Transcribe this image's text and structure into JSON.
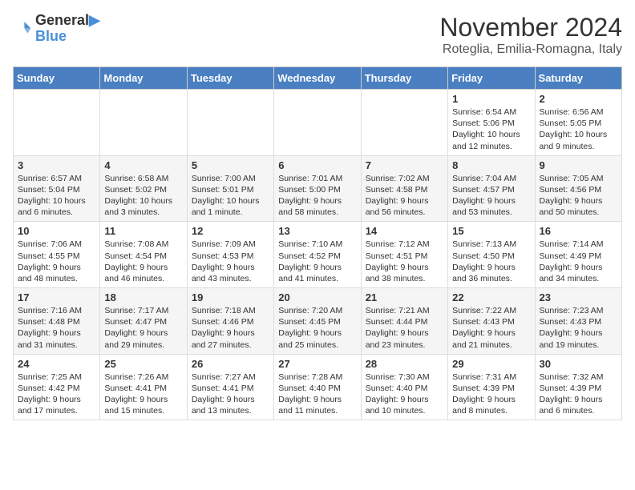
{
  "header": {
    "logo_line1": "General",
    "logo_line2": "Blue",
    "month": "November 2024",
    "location": "Roteglia, Emilia-Romagna, Italy"
  },
  "days_of_week": [
    "Sunday",
    "Monday",
    "Tuesday",
    "Wednesday",
    "Thursday",
    "Friday",
    "Saturday"
  ],
  "weeks": [
    [
      {
        "day": "",
        "info": ""
      },
      {
        "day": "",
        "info": ""
      },
      {
        "day": "",
        "info": ""
      },
      {
        "day": "",
        "info": ""
      },
      {
        "day": "",
        "info": ""
      },
      {
        "day": "1",
        "info": "Sunrise: 6:54 AM\nSunset: 5:06 PM\nDaylight: 10 hours and 12 minutes."
      },
      {
        "day": "2",
        "info": "Sunrise: 6:56 AM\nSunset: 5:05 PM\nDaylight: 10 hours and 9 minutes."
      }
    ],
    [
      {
        "day": "3",
        "info": "Sunrise: 6:57 AM\nSunset: 5:04 PM\nDaylight: 10 hours and 6 minutes."
      },
      {
        "day": "4",
        "info": "Sunrise: 6:58 AM\nSunset: 5:02 PM\nDaylight: 10 hours and 3 minutes."
      },
      {
        "day": "5",
        "info": "Sunrise: 7:00 AM\nSunset: 5:01 PM\nDaylight: 10 hours and 1 minute."
      },
      {
        "day": "6",
        "info": "Sunrise: 7:01 AM\nSunset: 5:00 PM\nDaylight: 9 hours and 58 minutes."
      },
      {
        "day": "7",
        "info": "Sunrise: 7:02 AM\nSunset: 4:58 PM\nDaylight: 9 hours and 56 minutes."
      },
      {
        "day": "8",
        "info": "Sunrise: 7:04 AM\nSunset: 4:57 PM\nDaylight: 9 hours and 53 minutes."
      },
      {
        "day": "9",
        "info": "Sunrise: 7:05 AM\nSunset: 4:56 PM\nDaylight: 9 hours and 50 minutes."
      }
    ],
    [
      {
        "day": "10",
        "info": "Sunrise: 7:06 AM\nSunset: 4:55 PM\nDaylight: 9 hours and 48 minutes."
      },
      {
        "day": "11",
        "info": "Sunrise: 7:08 AM\nSunset: 4:54 PM\nDaylight: 9 hours and 46 minutes."
      },
      {
        "day": "12",
        "info": "Sunrise: 7:09 AM\nSunset: 4:53 PM\nDaylight: 9 hours and 43 minutes."
      },
      {
        "day": "13",
        "info": "Sunrise: 7:10 AM\nSunset: 4:52 PM\nDaylight: 9 hours and 41 minutes."
      },
      {
        "day": "14",
        "info": "Sunrise: 7:12 AM\nSunset: 4:51 PM\nDaylight: 9 hours and 38 minutes."
      },
      {
        "day": "15",
        "info": "Sunrise: 7:13 AM\nSunset: 4:50 PM\nDaylight: 9 hours and 36 minutes."
      },
      {
        "day": "16",
        "info": "Sunrise: 7:14 AM\nSunset: 4:49 PM\nDaylight: 9 hours and 34 minutes."
      }
    ],
    [
      {
        "day": "17",
        "info": "Sunrise: 7:16 AM\nSunset: 4:48 PM\nDaylight: 9 hours and 31 minutes."
      },
      {
        "day": "18",
        "info": "Sunrise: 7:17 AM\nSunset: 4:47 PM\nDaylight: 9 hours and 29 minutes."
      },
      {
        "day": "19",
        "info": "Sunrise: 7:18 AM\nSunset: 4:46 PM\nDaylight: 9 hours and 27 minutes."
      },
      {
        "day": "20",
        "info": "Sunrise: 7:20 AM\nSunset: 4:45 PM\nDaylight: 9 hours and 25 minutes."
      },
      {
        "day": "21",
        "info": "Sunrise: 7:21 AM\nSunset: 4:44 PM\nDaylight: 9 hours and 23 minutes."
      },
      {
        "day": "22",
        "info": "Sunrise: 7:22 AM\nSunset: 4:43 PM\nDaylight: 9 hours and 21 minutes."
      },
      {
        "day": "23",
        "info": "Sunrise: 7:23 AM\nSunset: 4:43 PM\nDaylight: 9 hours and 19 minutes."
      }
    ],
    [
      {
        "day": "24",
        "info": "Sunrise: 7:25 AM\nSunset: 4:42 PM\nDaylight: 9 hours and 17 minutes."
      },
      {
        "day": "25",
        "info": "Sunrise: 7:26 AM\nSunset: 4:41 PM\nDaylight: 9 hours and 15 minutes."
      },
      {
        "day": "26",
        "info": "Sunrise: 7:27 AM\nSunset: 4:41 PM\nDaylight: 9 hours and 13 minutes."
      },
      {
        "day": "27",
        "info": "Sunrise: 7:28 AM\nSunset: 4:40 PM\nDaylight: 9 hours and 11 minutes."
      },
      {
        "day": "28",
        "info": "Sunrise: 7:30 AM\nSunset: 4:40 PM\nDaylight: 9 hours and 10 minutes."
      },
      {
        "day": "29",
        "info": "Sunrise: 7:31 AM\nSunset: 4:39 PM\nDaylight: 9 hours and 8 minutes."
      },
      {
        "day": "30",
        "info": "Sunrise: 7:32 AM\nSunset: 4:39 PM\nDaylight: 9 hours and 6 minutes."
      }
    ]
  ]
}
